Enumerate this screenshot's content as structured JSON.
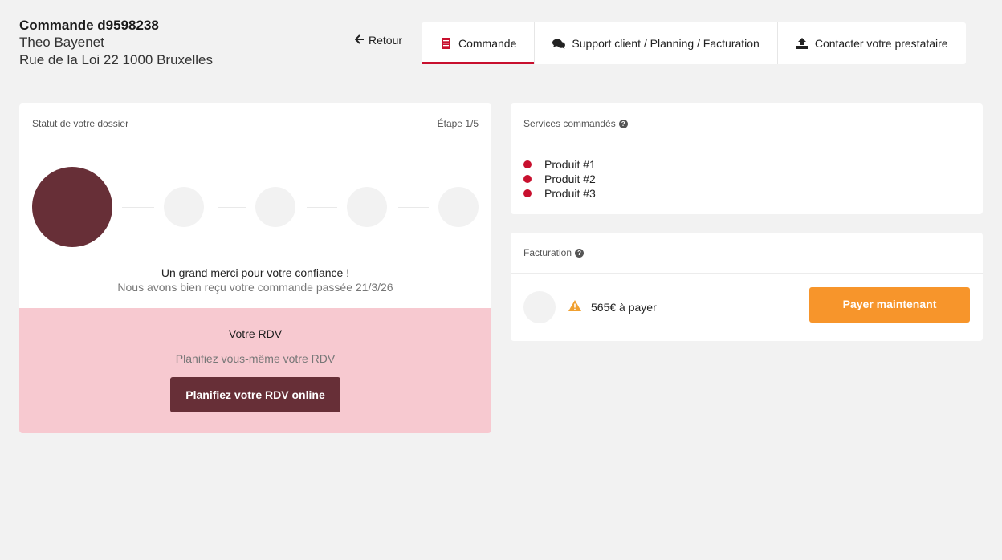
{
  "header": {
    "order_id": "Commande d9598238",
    "customer_name": "Theo Bayenet",
    "customer_address": "Rue de la Loi 22 1000 Bruxelles"
  },
  "nav": {
    "back_label": "Retour",
    "tabs": [
      {
        "label": "Commande",
        "icon": "document-icon",
        "active": true
      },
      {
        "label": "Support client / Planning / Facturation",
        "icon": "chat-icon",
        "active": false
      },
      {
        "label": "Contacter votre prestataire",
        "icon": "upload-icon",
        "active": false
      }
    ]
  },
  "status": {
    "title": "Statut de votre dossier",
    "step_label": "Étape 1/5",
    "current_step": 1,
    "total_steps": 5,
    "thanks": "Un grand merci pour votre confiance !",
    "received": "Nous avons bien reçu votre commande passée 21/3/26"
  },
  "rdv": {
    "title": "Votre RDV",
    "subtitle": "Planifiez vous-même votre RDV",
    "button_label": "Planifiez votre RDV online"
  },
  "services": {
    "title": "Services commandés",
    "items": [
      "Produit #1",
      "Produit #2",
      "Produit #3"
    ]
  },
  "billing": {
    "title": "Facturation",
    "amount_text": "565€ à payer",
    "pay_button_label": "Payer maintenant"
  },
  "colors": {
    "accent_red": "#c8102e",
    "brand_maroon": "#672f37",
    "rdv_background": "#f7c9d0",
    "pay_orange": "#f7952b",
    "warning_orange": "#f0a030"
  }
}
